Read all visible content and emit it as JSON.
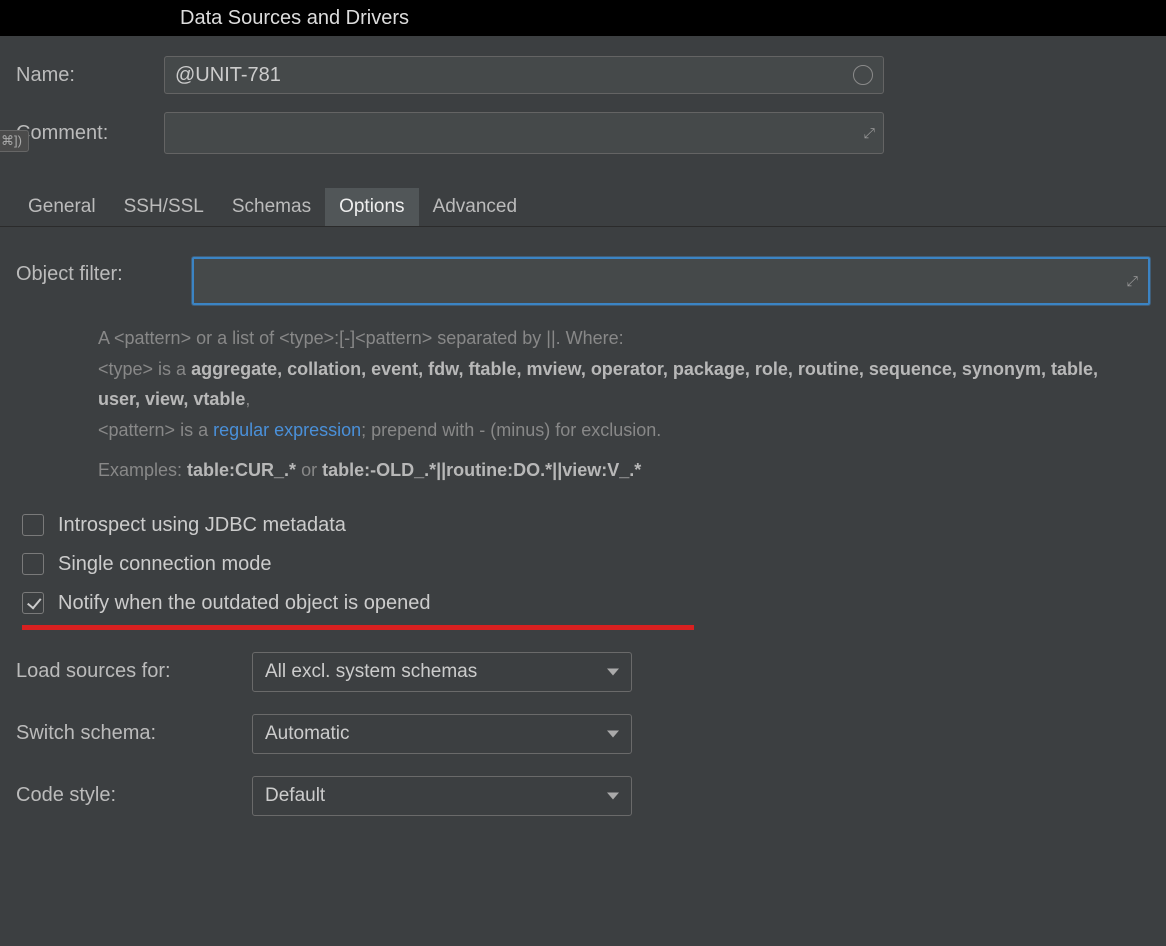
{
  "window": {
    "title": "Data Sources and Drivers"
  },
  "form": {
    "name_label": "Name:",
    "name_value": "@UNIT-781",
    "comment_label": "Comment:",
    "comment_value": "",
    "hint_badge": "⌘])"
  },
  "tabs": {
    "general": "General",
    "ssh_ssl": "SSH/SSL",
    "schemas": "Schemas",
    "options": "Options",
    "advanced": "Advanced",
    "active": "options"
  },
  "options": {
    "object_filter_label": "Object filter:",
    "object_filter_value": "",
    "help": {
      "line1_a": "A <pattern> or a list of <type>:[-]<pattern> separated by ||. Where:",
      "line2_a": "<type> is a ",
      "line2_types": "aggregate, collation, event, fdw, ftable, mview, operator, package, role, routine, sequence, synonym, table, user, view, vtable",
      "line2_end": ",",
      "line3_a": "<pattern> is a ",
      "line3_link": "regular expression",
      "line3_b": "; prepend with - (minus) for exclusion.",
      "examples_label": "Examples: ",
      "examples_1": "table:CUR_.*",
      "examples_or": " or ",
      "examples_2": "table:-OLD_.*||routine:DO.*||view:V_.*"
    },
    "checkboxes": {
      "introspect": {
        "label": "Introspect using JDBC metadata",
        "checked": false
      },
      "single_conn": {
        "label": "Single connection mode",
        "checked": false
      },
      "notify_outdated": {
        "label": "Notify when the outdated object is opened",
        "checked": true
      }
    },
    "dropdowns": {
      "load_sources": {
        "label": "Load sources for:",
        "value": "All excl. system schemas"
      },
      "switch_schema": {
        "label": "Switch schema:",
        "value": "Automatic"
      },
      "code_style": {
        "label": "Code style:",
        "value": "Default"
      }
    }
  }
}
